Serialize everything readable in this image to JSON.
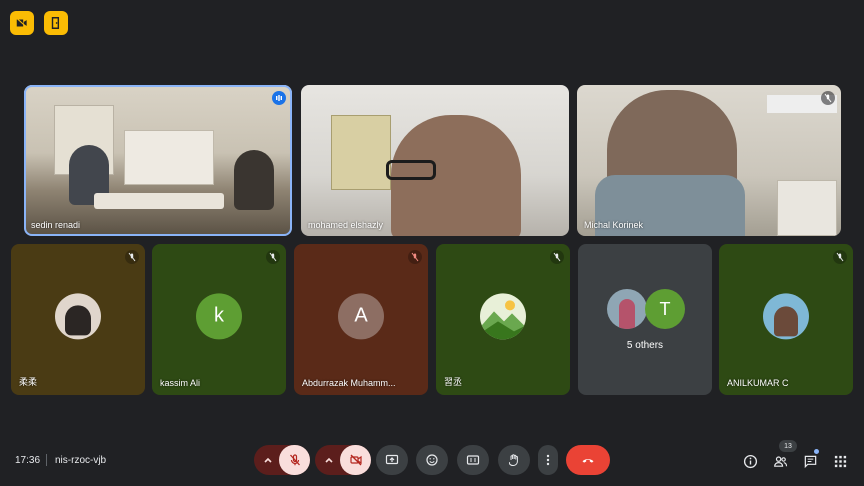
{
  "meeting": {
    "time": "17:36",
    "code": "nis-rzoc-vjb",
    "participant_count": "13"
  },
  "host_controls": [
    {
      "icon": "video-off-lock-icon"
    },
    {
      "icon": "door-exit-icon"
    }
  ],
  "video_tiles": [
    {
      "name": "sedin renadi",
      "speaking": true,
      "indicator": "audio-level-icon"
    },
    {
      "name": "mohamed elshazly",
      "speaking": false
    },
    {
      "name": "Michal Korinek",
      "speaking": false,
      "indicator": "mic-off-icon"
    }
  ],
  "avatar_tiles": [
    {
      "name": "柔柔",
      "bg": "#4a3b14",
      "avatar": "photo",
      "indicator": "mic-off-icon"
    },
    {
      "name": "kassim Ali",
      "bg": "#2e4a14",
      "avatar_letter": "k",
      "avatar_bg": "#5e9e33",
      "indicator": "mic-off-icon"
    },
    {
      "name": "Abdurrazak Muhamm...",
      "bg": "#5a2a18",
      "avatar_letter": "A",
      "avatar_bg": "#8d6e63",
      "indicator": "mic-off-icon"
    },
    {
      "name": "習丞",
      "bg": "#2e4a14",
      "avatar": "landscape",
      "indicator": "mic-off-icon"
    },
    {
      "name": "5 others",
      "bg": "#3c4043",
      "avatar_letter": "T",
      "avatar_bg": "#5e9e33"
    },
    {
      "name": "ANILKUMAR C",
      "bg": "#2e4a14",
      "avatar": "photo",
      "indicator": "mic-off-icon"
    }
  ],
  "colors": {
    "background": "#202124",
    "host_accent": "#fbbc04",
    "end_call": "#ea4335",
    "speaking_border": "#8ab4f8",
    "muted_control": "#f9dedc"
  },
  "controls": [
    {
      "name": "mic-options",
      "icon": "chevron-up-icon"
    },
    {
      "name": "mic-toggle",
      "icon": "mic-off-icon"
    },
    {
      "name": "camera-options",
      "icon": "chevron-up-icon"
    },
    {
      "name": "camera-toggle",
      "icon": "video-off-icon"
    },
    {
      "name": "present",
      "icon": "present-screen-icon"
    },
    {
      "name": "reactions",
      "icon": "emoji-icon"
    },
    {
      "name": "captions",
      "icon": "captions-icon"
    },
    {
      "name": "raise-hand",
      "icon": "hand-icon"
    },
    {
      "name": "more-options",
      "icon": "more-vert-icon"
    },
    {
      "name": "end-call",
      "icon": "call-end-icon"
    }
  ],
  "right_controls": [
    {
      "name": "meeting-details",
      "icon": "info-icon"
    },
    {
      "name": "people",
      "icon": "people-icon"
    },
    {
      "name": "chat",
      "icon": "chat-icon"
    },
    {
      "name": "activities",
      "icon": "apps-icon"
    }
  ]
}
